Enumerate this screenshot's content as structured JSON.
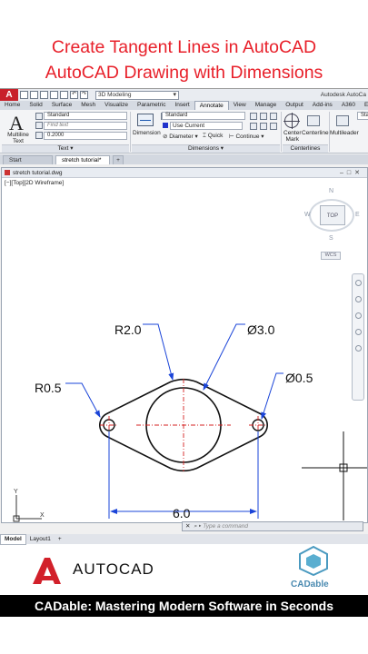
{
  "headline": {
    "line1": "Create Tangent Lines in AutoCAD",
    "line2": "AutoCAD Drawing with Dimensions"
  },
  "quick_access": {
    "app_letter": "A",
    "workspace": "3D Modeling",
    "right_title": "Autodesk AutoCa"
  },
  "ribbon_tabs": [
    "Home",
    "Solid",
    "Surface",
    "Mesh",
    "Visualize",
    "Parametric",
    "Insert",
    "Annotate",
    "View",
    "Manage",
    "Output",
    "Add-ins",
    "A360",
    "Express"
  ],
  "active_tab": "Annotate",
  "ribbon": {
    "multiline_text_label1": "Multiline",
    "multiline_text_label2": "Text",
    "text_style": "Standard",
    "find_text": "Find text",
    "text_height": "0.2000",
    "text_panel": "Text ▾",
    "dimension_label": "Dimension",
    "dim_style": "Standard",
    "dim_layer": "Use Current",
    "diameter": "Diameter ▾",
    "quick": "Quick",
    "continue": "Continue ▾",
    "dimensions_panel": "Dimensions ▾",
    "center_mark_label1": "Center",
    "center_mark_label2": "Mark",
    "centerline_label": "Centerline",
    "centerlines_panel": "Centerlines",
    "multileader_label": "Multileader",
    "leader_style": "Stan"
  },
  "file_tabs": {
    "start": "Start",
    "active": "stretch tutorial*",
    "plus": "+"
  },
  "drawing_window": {
    "title": "stretch tutorial.dwg",
    "viewport_label": "[−][Top][2D Wireframe]"
  },
  "viewcube": {
    "north": "N",
    "south": "S",
    "east": "E",
    "west": "W",
    "top": "TOP",
    "wcs": "WCS"
  },
  "drawing": {
    "dim_r2": "R2.0",
    "dim_d3": "Ø3.0",
    "dim_r05": "R0.5",
    "dim_d05": "Ø0.5",
    "dim_len": "6.0",
    "ucs_y": "Y",
    "ucs_x": "X"
  },
  "command_line": {
    "close": "✕",
    "placeholder": "Type a command"
  },
  "layout_tabs": [
    "Model",
    "Layout1",
    "+"
  ],
  "footer": {
    "autocad_word": "AUTOCAD",
    "cadable_word": "CADable",
    "tagline": "CADable: Mastering Modern Software in Seconds"
  },
  "colors": {
    "headline": "#e8202a",
    "dimension": "#1a44d8",
    "center": "#d42020",
    "geometry": "#111111"
  }
}
